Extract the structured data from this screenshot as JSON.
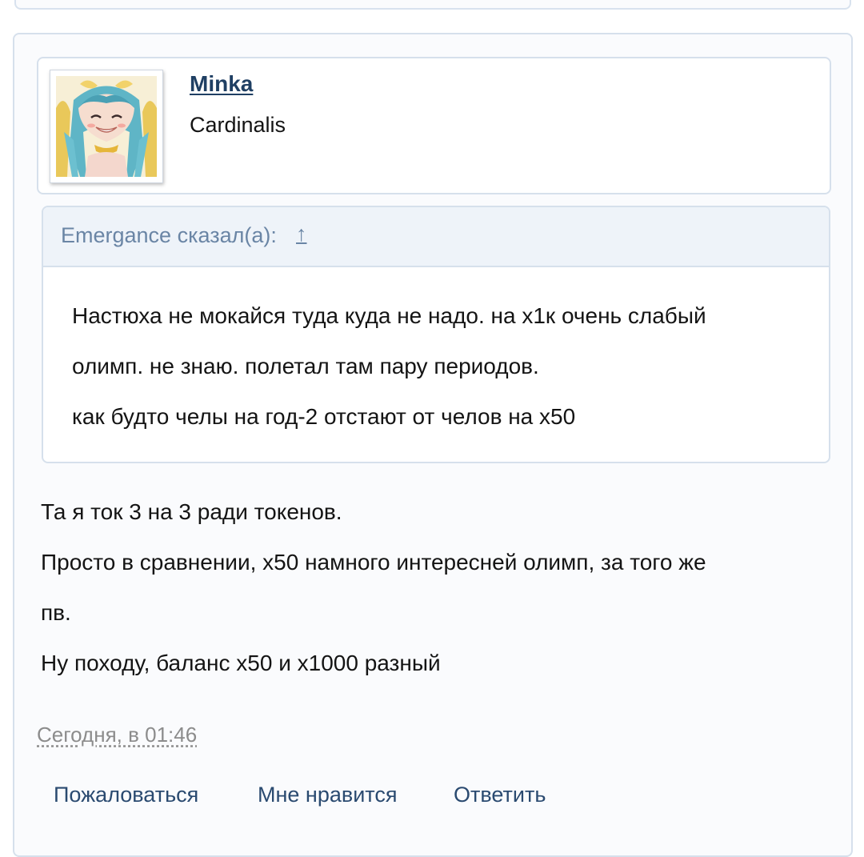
{
  "post": {
    "author": {
      "name": "Minka",
      "title": "Cardinalis",
      "avatar_icon": "anime-avatar"
    },
    "quote": {
      "author_line": "Emergance сказал(а):",
      "jump_icon": "arrow-up-icon",
      "jump_label": "↑",
      "lines": [
        "Настюха не мокайся туда куда не надо. на х1к очень слабый",
        "олимп. не знаю. полетал там пару периодов.",
        "как будто челы на год-2 отстают от челов на х50"
      ]
    },
    "message_lines": [
      "Та я ток 3 на 3 ради токенов.",
      "Просто в сравнении, х50 намного интересней олимп, за того же",
      "пв.",
      "Ну походу, баланс х50 и х1000 разный"
    ],
    "timestamp": "Сегодня, в 01:46",
    "actions": {
      "report": "Пожаловаться",
      "like": "Мне нравится",
      "reply": "Ответить"
    }
  },
  "colors": {
    "link": "#1f3f63",
    "quote_author": "#6a85a5",
    "action": "#2a4a70",
    "border": "#d6e0ec"
  }
}
